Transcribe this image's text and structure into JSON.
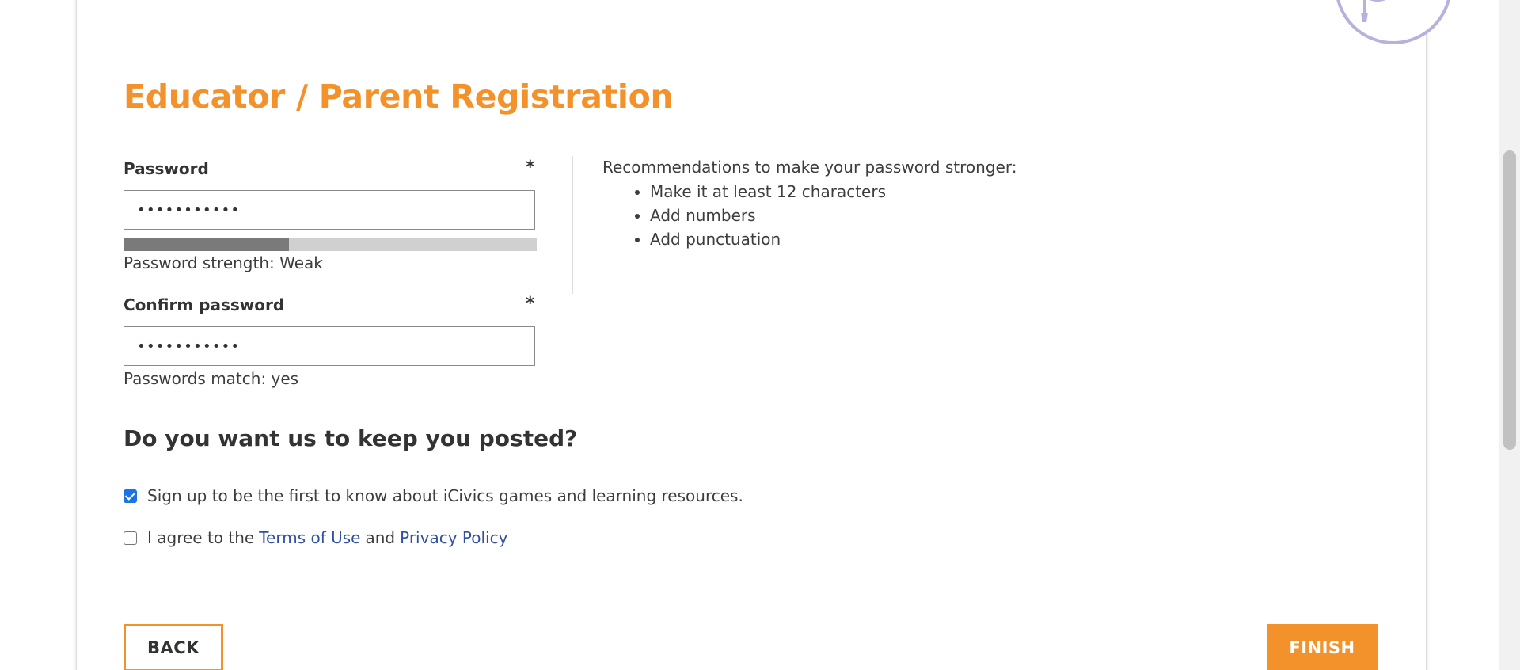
{
  "progress": {
    "steps": [
      "done",
      "done",
      "done",
      "done",
      "current"
    ]
  },
  "header": {
    "title": "Educator / Parent Registration",
    "badge_icon": "graduation-cap-icon"
  },
  "password": {
    "label": "Password",
    "required_mark": "*",
    "value": "•••••••••••",
    "strength_fraction": 0.4,
    "strength_text": "Password strength: Weak"
  },
  "confirm": {
    "label": "Confirm password",
    "required_mark": "*",
    "value": "•••••••••••",
    "match_text": "Passwords match: yes"
  },
  "recommendations": {
    "intro": "Recommendations to make your password stronger:",
    "items": [
      "Make it at least 12 characters",
      "Add numbers",
      "Add punctuation"
    ]
  },
  "newsletter": {
    "heading": "Do you want us to keep you posted?",
    "signup_label": "Sign up to be the first to know about iCivics games and learning resources.",
    "signup_checked": true
  },
  "terms": {
    "prefix": "I agree to the",
    "terms_link": "Terms of Use",
    "and": "and",
    "privacy_link": "Privacy Policy",
    "checked": false
  },
  "buttons": {
    "back": "BACK",
    "finish": "FINISH"
  },
  "colors": {
    "accent": "#f3922b",
    "step_done": "#17a96b",
    "step_current": "#555555",
    "link": "#2f4fa2",
    "badge": "#b8b1de"
  }
}
